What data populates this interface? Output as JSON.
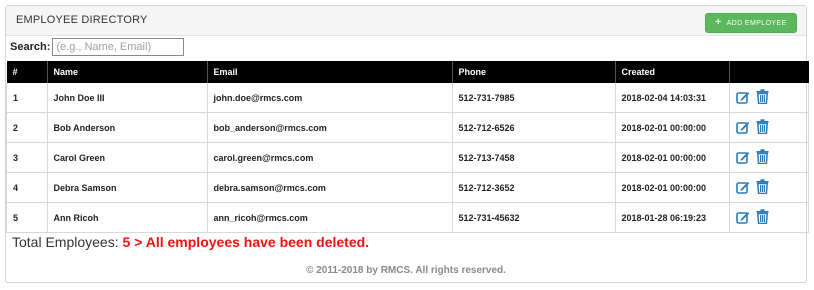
{
  "panel": {
    "title": "EMPLOYEE DIRECTORY",
    "add_button_label": "ADD  EMPLOYEE",
    "add_button_icon": "plus-icon"
  },
  "search": {
    "label": "Search:",
    "placeholder": "(e.g., Name, Email)",
    "value": ""
  },
  "table": {
    "headers": [
      "#",
      "Name",
      "Email",
      "Phone",
      "Created",
      ""
    ],
    "rows": [
      {
        "num": "1",
        "name": "John Doe III",
        "email": "john.doe@rmcs.com",
        "phone": "512-731-7985",
        "created": "2018-02-04 14:03:31"
      },
      {
        "num": "2",
        "name": "Bob Anderson",
        "email": "bob_anderson@rmcs.com",
        "phone": "512-712-6526",
        "created": "2018-02-01 00:00:00"
      },
      {
        "num": "3",
        "name": "Carol Green",
        "email": "carol.green@rmcs.com",
        "phone": "512-713-7458",
        "created": "2018-02-01 00:00:00"
      },
      {
        "num": "4",
        "name": "Debra Samson",
        "email": "debra.samson@rmcs.com",
        "phone": "512-712-3652",
        "created": "2018-02-01 00:00:00"
      },
      {
        "num": "5",
        "name": "Ann Ricoh",
        "email": "ann_ricoh@rmcs.com",
        "phone": "512-731-45632",
        "created": "2018-01-28 06:19:23"
      }
    ],
    "row_actions": [
      "edit-icon",
      "trash-icon"
    ]
  },
  "footer": {
    "total_label": "Total Employees:",
    "total_count": "5",
    "message": "> All employees have been deleted.",
    "copyright": "© 2011-2018 by RMCS. All rights reserved."
  },
  "colors": {
    "accent_green": "#5cb85c",
    "icon_blue": "#2a7ab8",
    "alert_red": "#e11111",
    "header_black": "#000000"
  }
}
